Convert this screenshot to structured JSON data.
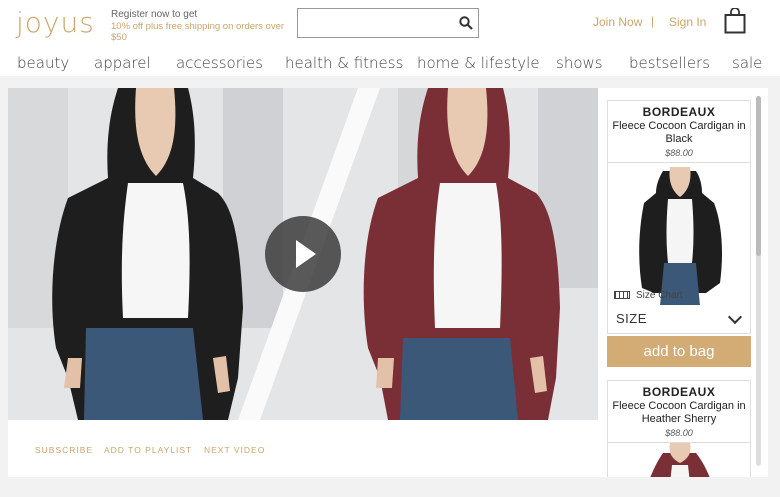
{
  "header": {
    "logo": "joyus",
    "promo_line1": "Register now to get",
    "promo_line2": "10% off plus free shipping on orders over $50",
    "search_placeholder": "",
    "join_label": "Join Now",
    "separator": "|",
    "signin_label": "Sign In"
  },
  "nav": {
    "items": [
      "beauty",
      "apparel",
      "accessories",
      "health & fitness",
      "home & lifestyle",
      "shows",
      "bestsellers",
      "sale"
    ]
  },
  "video": {
    "actions": [
      "SUBSCRIBE",
      "ADD TO PLAYLIST",
      "NEXT VIDEO"
    ]
  },
  "products": [
    {
      "brand": "BORDEAUX",
      "name": "Fleece Cocoon Cardigan in Black",
      "price": "$88.00",
      "size_chart_label": "Size Chart",
      "size_label": "SIZE",
      "add_label": "add to bag"
    },
    {
      "brand": "BORDEAUX",
      "name": "Fleece Cocoon Cardigan in Heather Sherry",
      "price": "$88.00"
    }
  ],
  "colors": {
    "accent": "#c9a66b",
    "button": "#d2ac74",
    "black_cardigan": "#1e1e1e",
    "sherry_cardigan": "#7a2e36"
  }
}
